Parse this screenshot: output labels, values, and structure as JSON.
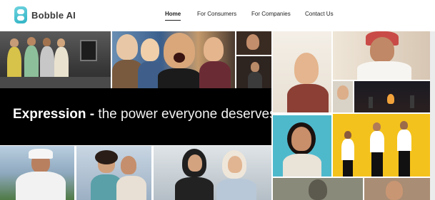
{
  "brand": {
    "name": "Bobble AI",
    "accent": "#3bbccb"
  },
  "nav": {
    "home": "Home",
    "consumers": "For Consumers",
    "companies": "For Companies",
    "contact": "Contact Us"
  },
  "hero": {
    "headline_bold": "Expression -",
    "headline_rest": " the power everyone deserves"
  }
}
